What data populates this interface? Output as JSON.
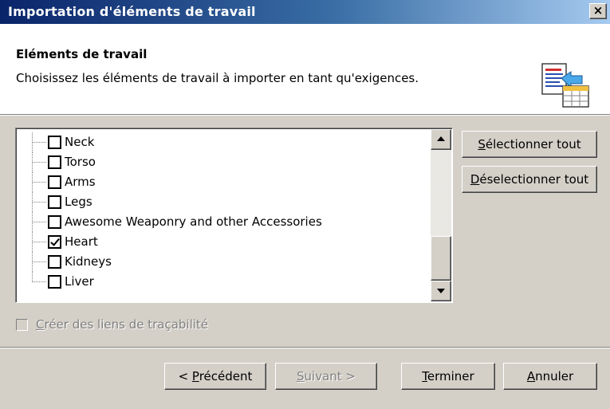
{
  "window": {
    "title": "Importation d'éléments de travail",
    "close_glyph": "×"
  },
  "header": {
    "title": "Eléments de travail",
    "description": "Choisissez les éléments de travail à importer en tant qu'exigences.",
    "icon": "import-requirements-icon"
  },
  "tree": {
    "items": [
      {
        "label": "Neck",
        "checked": false
      },
      {
        "label": "Torso",
        "checked": false
      },
      {
        "label": "Arms",
        "checked": false
      },
      {
        "label": "Legs",
        "checked": false
      },
      {
        "label": "Awesome Weaponry and other Accessories",
        "checked": false
      },
      {
        "label": "Heart",
        "checked": true
      },
      {
        "label": "Kidneys",
        "checked": false
      },
      {
        "label": "Liver",
        "checked": false
      }
    ],
    "scroll_position": 0.85
  },
  "side_buttons": {
    "select_all": {
      "mnemonic": "S",
      "rest": "électionner tout"
    },
    "deselect_all": {
      "mnemonic": "D",
      "rest": "éselectionner tout"
    }
  },
  "traceability": {
    "mnemonic": "C",
    "rest": "réer des liens de traçabilité",
    "enabled": false,
    "checked": false
  },
  "footer": {
    "previous": {
      "prefix": "< ",
      "mnemonic": "P",
      "rest": "récédent"
    },
    "next": {
      "mnemonic": "S",
      "rest": "uivant >",
      "enabled": false
    },
    "finish": {
      "mnemonic": "T",
      "rest": "erminer"
    },
    "cancel": {
      "mnemonic": "A",
      "rest": "nnuler"
    }
  },
  "colors": {
    "titlebar_start": "#0a246a",
    "titlebar_end": "#a6caf0",
    "dialog_face": "#d4d0c8",
    "disabled_text": "#808080"
  }
}
